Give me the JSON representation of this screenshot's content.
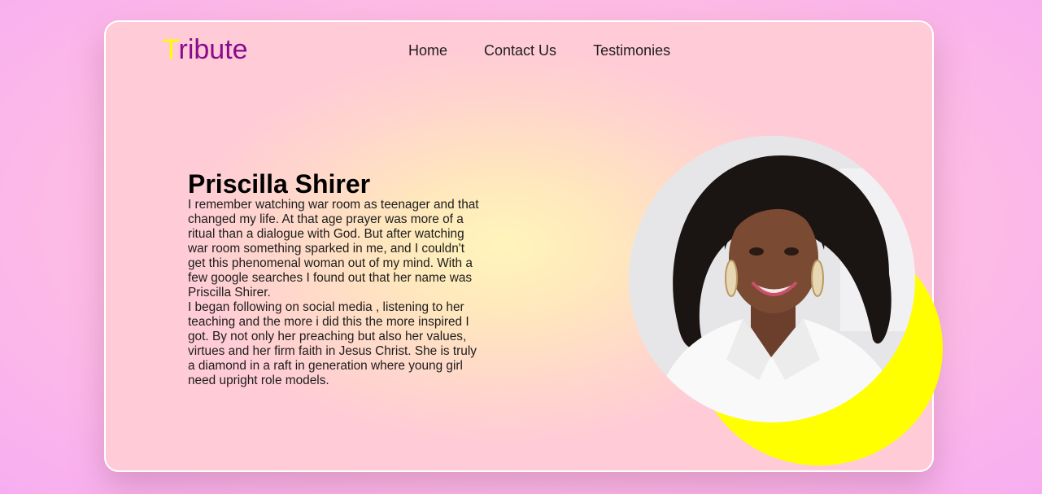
{
  "header": {
    "logo_first": "T",
    "logo_rest": "ribute",
    "nav": [
      {
        "label": "Home"
      },
      {
        "label": "Contact Us"
      },
      {
        "label": "Testimonies"
      }
    ]
  },
  "main": {
    "title": "Priscilla Shirer",
    "paragraph1": "I remember watching war room as teenager and that changed my life. At that age prayer was more of a ritual than a dialogue with God. But after watching war room something sparked in me, and I couldn't get this phenomenal woman out of my mind. With a few google searches I found out that her name was Priscilla Shirer.",
    "paragraph2": "I began following on social media , listening to her teaching and the more i did this the more inspired I got. By not only her preaching but also her values, virtues and her firm faith in Jesus Christ. She is truly a diamond in a raft in generation where young girl need upright role models."
  },
  "colors": {
    "logo_accent": "#ffff00",
    "logo_text": "#8a0a8f",
    "moon": "#ffff00"
  }
}
